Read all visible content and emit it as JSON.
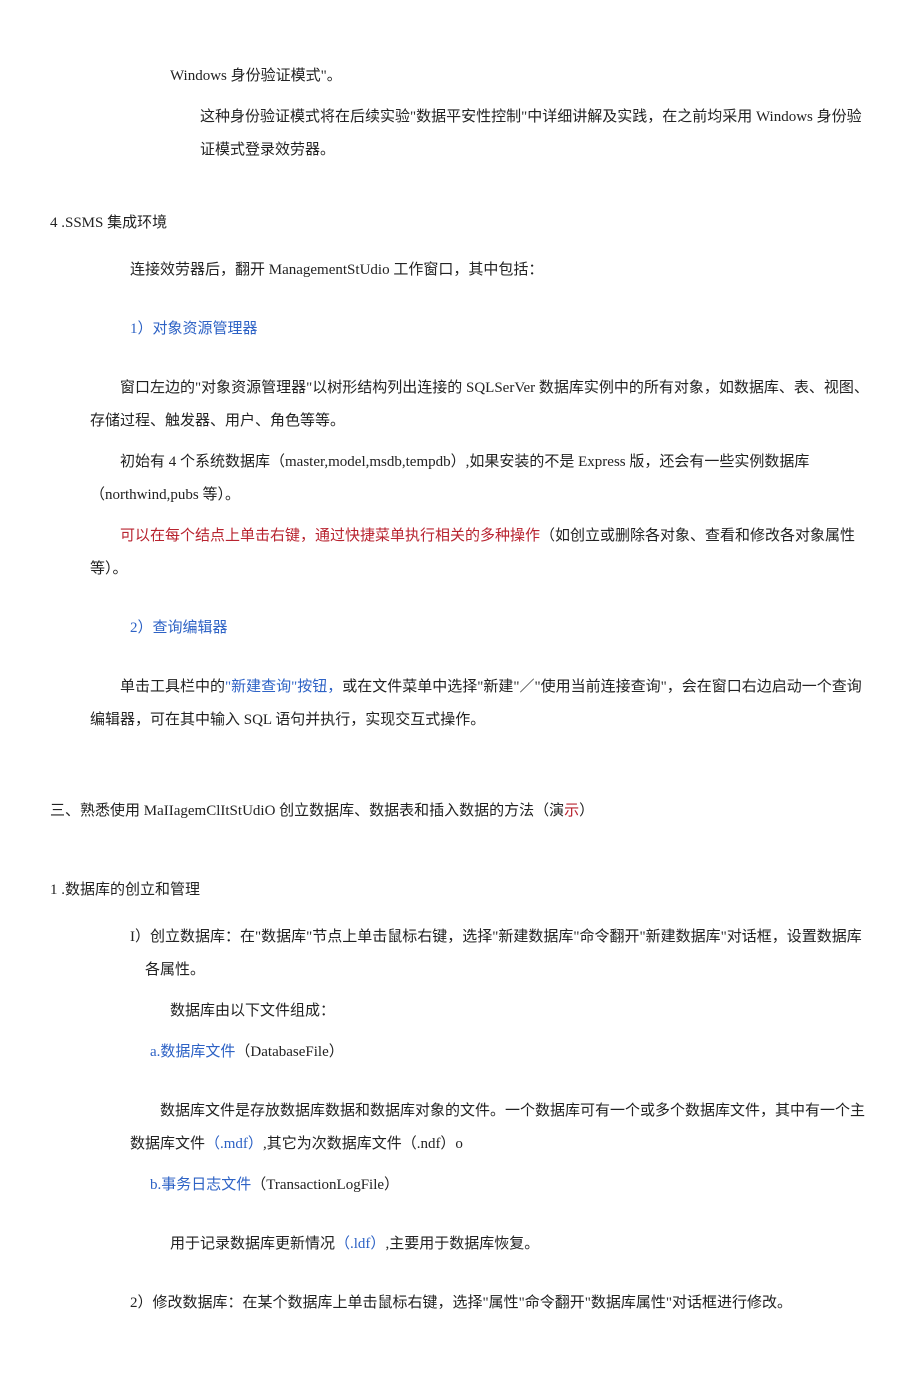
{
  "top": {
    "line1": "Windows 身份验证模式\"。",
    "line2": "这种身份验证模式将在后续实验\"数据平安性控制\"中详细讲解及实践，在之前均采用 Windows 身份验证模式登录效劳器。"
  },
  "section4": {
    "title": "4 .SSMS 集成环境",
    "intro": "连接效劳器后，翻开 ManagementStUdio 工作窗口，其中包括：",
    "item1": {
      "heading": "1）对象资源管理器",
      "p1": "窗口左边的\"对象资源管理器\"以树形结构列出连接的 SQLSerVer 数据库实例中的所有对象，如数据库、表、视图、存储过程、触发器、用户、角色等等。",
      "p2": "初始有 4 个系统数据库（master,model,msdb,tempdb）,如果安装的不是 Express 版，还会有一些实例数据库（northwind,pubs 等）。",
      "p3_red": "可以在每个结点上单击右键，通过快捷菜单执行相关的多种操作",
      "p3_black": "（如创立或删除各对象、查看和修改各对象属性等）。"
    },
    "item2": {
      "heading": "2）查询编辑器",
      "p1_pre": "单击工具栏中的",
      "p1_blue": "\"新建查询\"按钮，",
      "p1_post": "或在文件菜单中选择\"新建\"／\"使用当前连接查询\"，会在窗口右边启动一个查询编辑器，可在其中输入 SQL 语句并执行，实现交互式操作。"
    }
  },
  "sectionSan": {
    "title_pre": "三、熟悉使用 MaIIagemClItStUdiO 创立数据库、数据表和插入数据的方法（演",
    "title_red": "示",
    "title_post": "）"
  },
  "db": {
    "title": "1 .数据库的创立和管理",
    "i1": {
      "head": "I）创立数据库：在\"数据库\"节点上单击鼠标右键，选择\"新建数据库\"命令翻开\"新建数据库\"对话框，设置数据库各属性。",
      "p_files": "数据库由以下文件组成：",
      "a_blue": "a.数据库文件",
      "a_black": "（DatabaseFile）",
      "a_body_pre": "数据库文件是存放数据库数据和数据库对象的文件。一个数据库可有一个或多个数据库文件，其中有一个主数据库文件",
      "a_body_blue": "（.mdf）",
      "a_body_post": ",其它为次数据库文件（.ndf）o",
      "b_blue": "b.事务日志文件",
      "b_black": "（TransactionLogFile）",
      "b_body_pre": "用于记录数据库更新情况",
      "b_body_blue": "（.ldf）",
      "b_body_post": ",主要用于数据库恢复。"
    },
    "i2": "2）修改数据库：在某个数据库上单击鼠标右键，选择\"属性\"命令翻开\"数据库属性\"对话框进行修改。"
  }
}
